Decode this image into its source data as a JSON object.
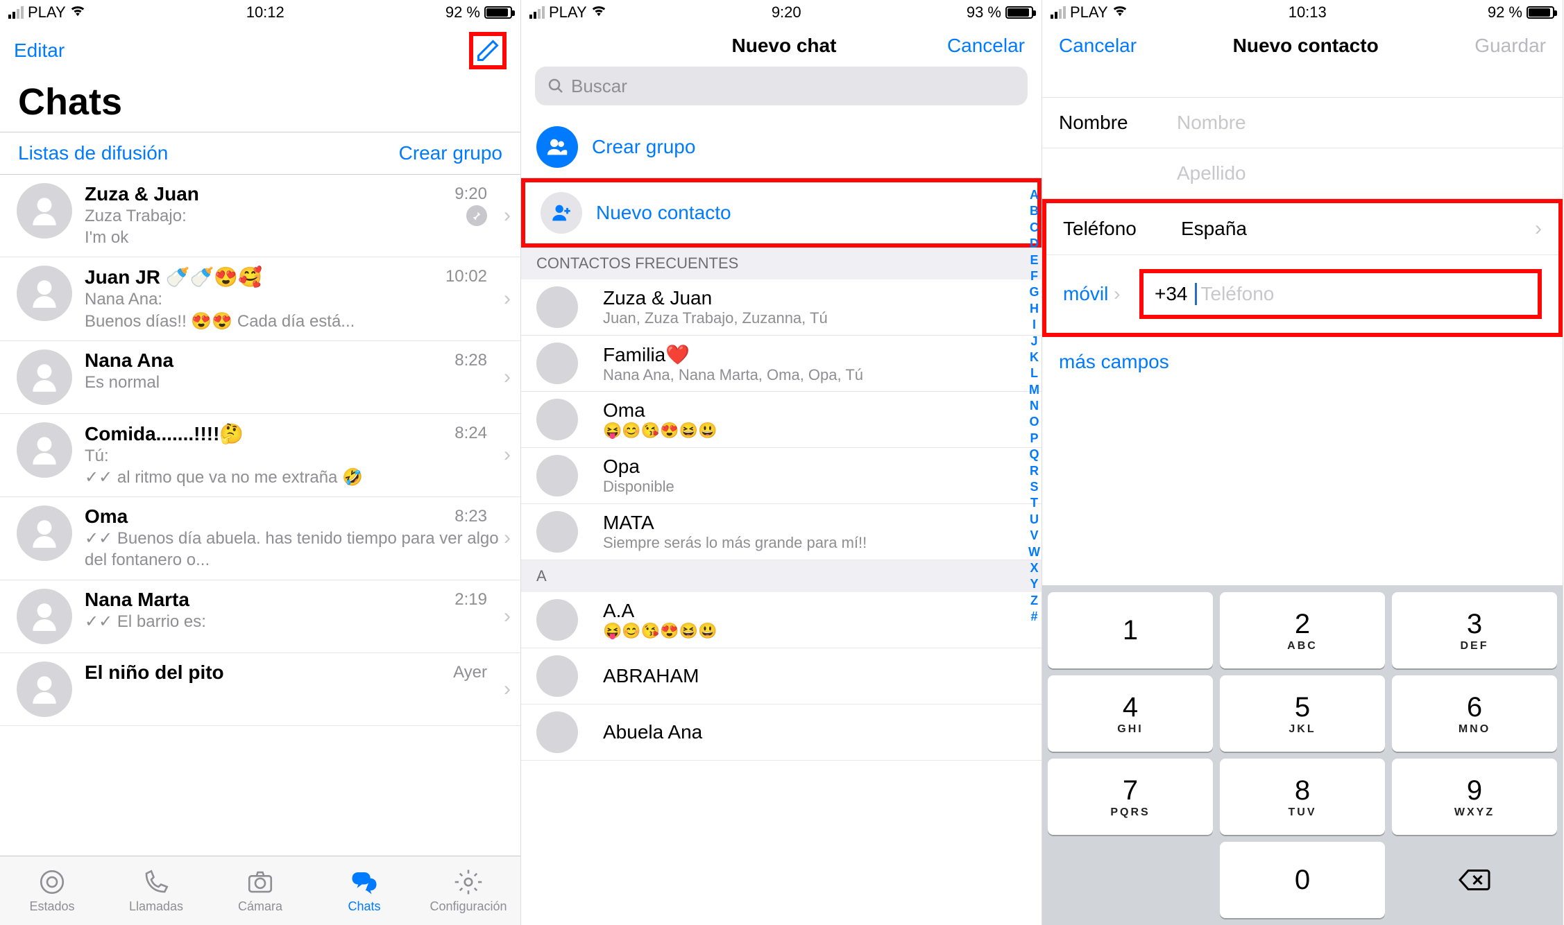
{
  "s1": {
    "status": {
      "carrier": "PLAY",
      "time": "10:12",
      "battery": "92 %"
    },
    "edit": "Editar",
    "title": "Chats",
    "broadcast": "Listas de difusión",
    "newgroup": "Crear grupo",
    "chats": [
      {
        "name": "Zuza & Juan",
        "line1": "Zuza Trabajo:",
        "line2": "I'm ok",
        "time": "9:20",
        "pin": true
      },
      {
        "name": "Juan JR 🍼🍼😍🥰",
        "line1": "Nana Ana:",
        "line2": "Buenos días!! 😍😍 Cada día está...",
        "time": "10:02"
      },
      {
        "name": "Nana Ana",
        "line1": "",
        "line2": "Es normal",
        "time": "8:28"
      },
      {
        "name": "Comida.......!!!!🤔",
        "line1": "Tú:",
        "line2": "✓✓ al ritmo que va no me extraña 🤣",
        "time": "8:24"
      },
      {
        "name": "Oma",
        "line1": "",
        "line2": "✓✓ Buenos día abuela. has tenido tiempo para ver algo del fontanero o...",
        "time": "8:23"
      },
      {
        "name": "Nana Marta",
        "line1": "",
        "line2": "✓✓ El barrio es:",
        "time": "2:19"
      },
      {
        "name": "El niño del pito",
        "line1": "",
        "line2": "",
        "time": "Ayer"
      }
    ],
    "tabs": [
      "Estados",
      "Llamadas",
      "Cámara",
      "Chats",
      "Configuración"
    ]
  },
  "s2": {
    "status": {
      "carrier": "PLAY",
      "time": "9:20",
      "battery": "93 %"
    },
    "title": "Nuevo chat",
    "cancel": "Cancelar",
    "search": "Buscar",
    "create_group": "Crear grupo",
    "new_contact": "Nuevo contacto",
    "freq": "CONTACTOS FRECUENTES",
    "contacts": [
      {
        "name": "Zuza & Juan",
        "sub": "Juan, Zuza Trabajo, Zuzanna, Tú"
      },
      {
        "name": "Familia❤️",
        "sub": "Nana Ana, Nana Marta, Oma, Opa, Tú"
      },
      {
        "name": "Oma",
        "sub": "😝😊😘😍😆😃"
      },
      {
        "name": "Opa",
        "sub": "Disponible"
      },
      {
        "name": "MATA",
        "sub": "Siempre serás lo más grande para mí!!"
      }
    ],
    "letter_hd": "A",
    "a_contacts": [
      {
        "name": "A.A",
        "sub": "😝😊😘😍😆😃"
      },
      {
        "name": "ABRAHAM",
        "sub": ""
      },
      {
        "name": "Abuela Ana",
        "sub": ""
      }
    ],
    "az": [
      "A",
      "B",
      "C",
      "D",
      "E",
      "F",
      "G",
      "H",
      "I",
      "J",
      "K",
      "L",
      "M",
      "N",
      "O",
      "P",
      "Q",
      "R",
      "S",
      "T",
      "U",
      "V",
      "W",
      "X",
      "Y",
      "Z",
      "#"
    ]
  },
  "s3": {
    "status": {
      "carrier": "PLAY",
      "time": "10:13",
      "battery": "92 %"
    },
    "cancel": "Cancelar",
    "title": "Nuevo contacto",
    "save": "Guardar",
    "name_label": "Nombre",
    "name_ph": "Nombre",
    "surname_ph": "Apellido",
    "phone_label": "Teléfono",
    "country": "España",
    "type": "móvil",
    "prefix": "+34",
    "phone_ph": "Teléfono",
    "more": "más campos",
    "keys": [
      {
        "n": "1",
        "l": ""
      },
      {
        "n": "2",
        "l": "ABC"
      },
      {
        "n": "3",
        "l": "DEF"
      },
      {
        "n": "4",
        "l": "GHI"
      },
      {
        "n": "5",
        "l": "JKL"
      },
      {
        "n": "6",
        "l": "MNO"
      },
      {
        "n": "7",
        "l": "PQRS"
      },
      {
        "n": "8",
        "l": "TUV"
      },
      {
        "n": "9",
        "l": "WXYZ"
      },
      {
        "n": "",
        "l": ""
      },
      {
        "n": "0",
        "l": ""
      },
      {
        "n": "del",
        "l": ""
      }
    ]
  }
}
